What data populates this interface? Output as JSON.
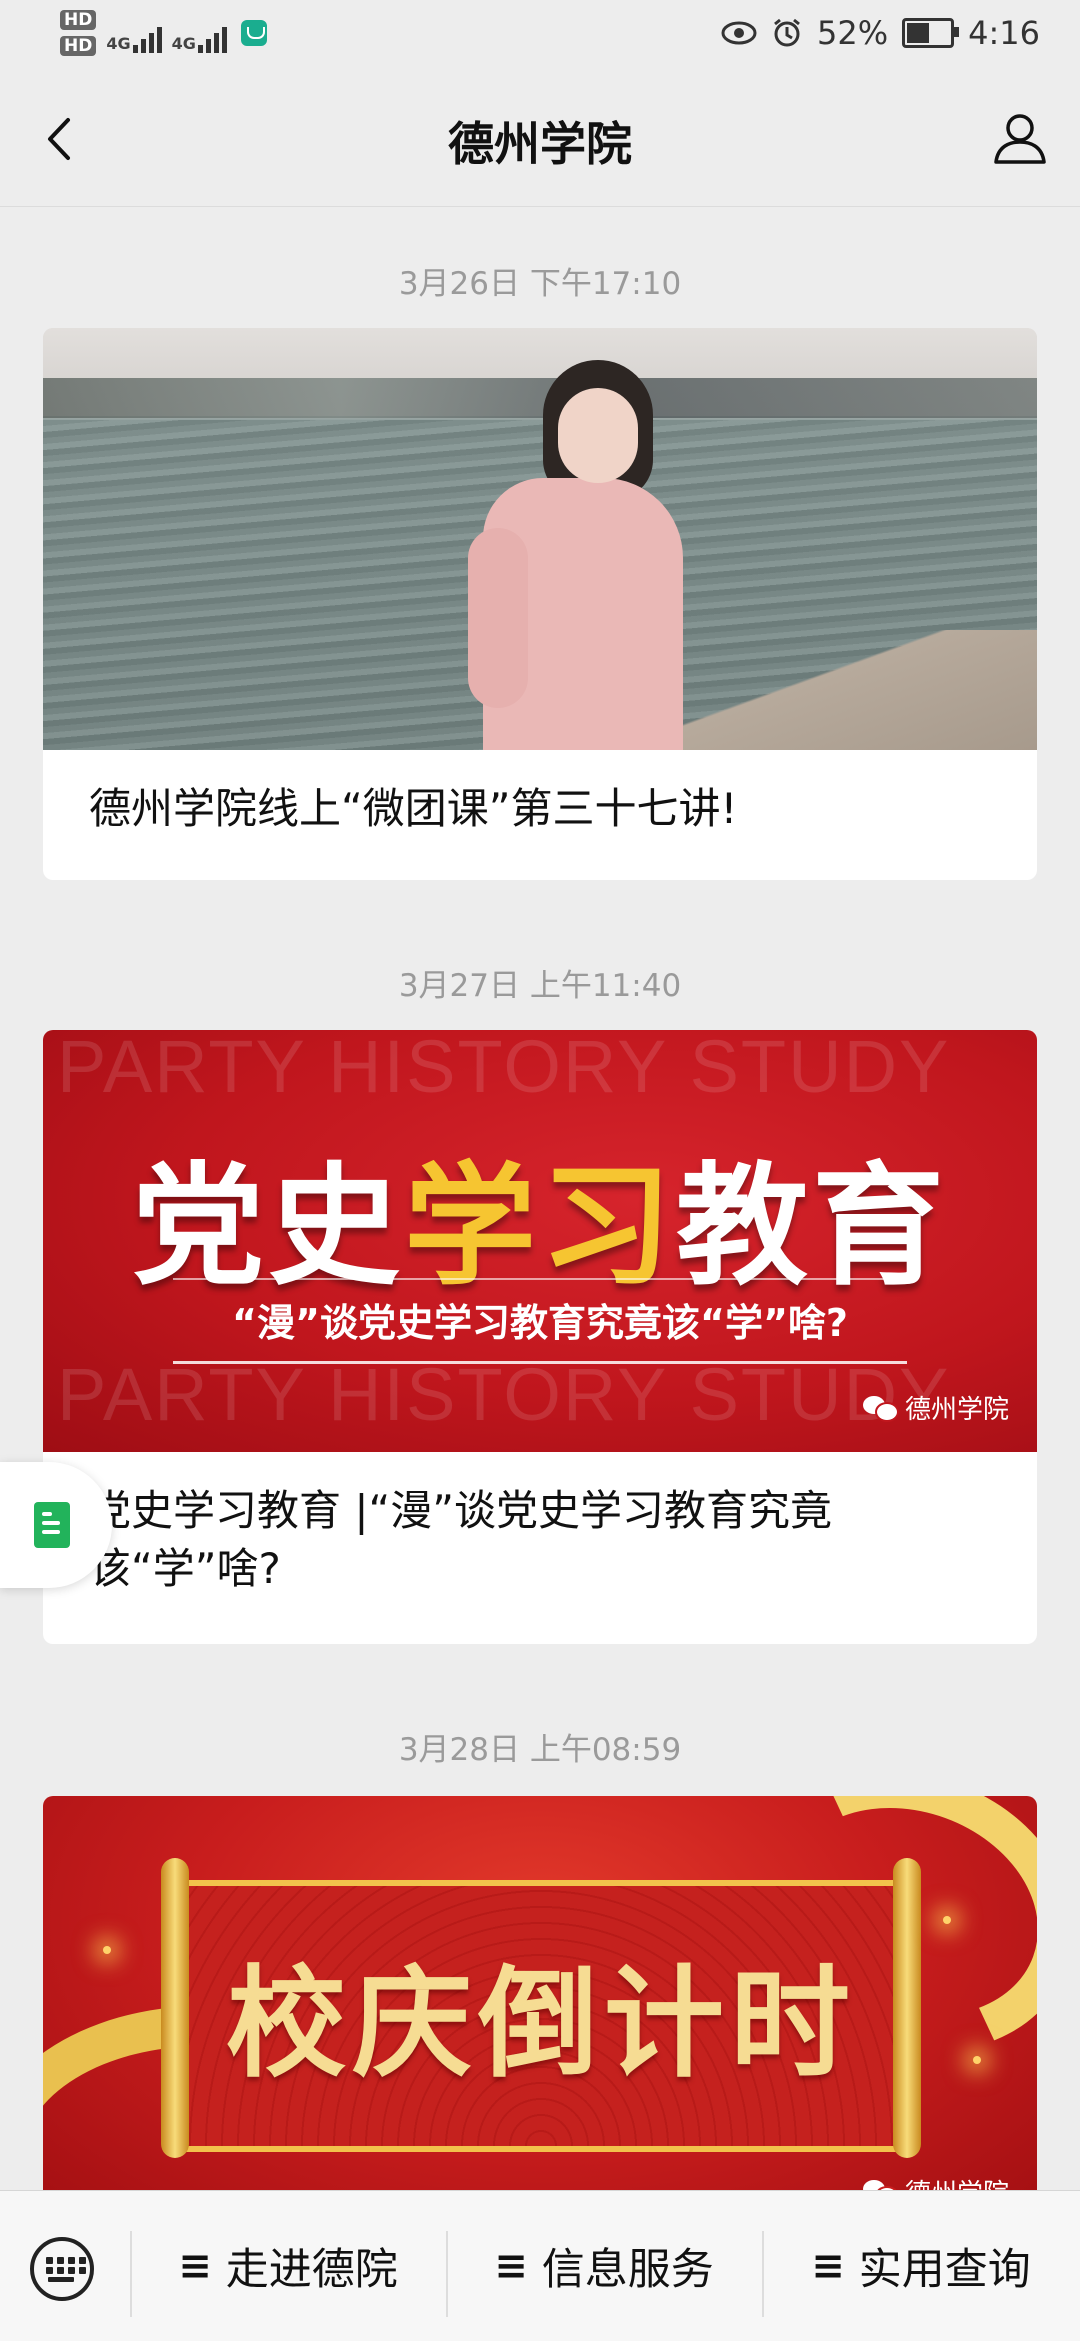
{
  "status_bar": {
    "hd1": "HD",
    "hd2": "HD",
    "net1": "4G",
    "net2": "4G",
    "battery_percent": "52%",
    "time": "4:16"
  },
  "header": {
    "title": "德州学院"
  },
  "feed": [
    {
      "date": "3月26日 下午17:10",
      "caption": "德州学院线上“微团课”第三十七讲!"
    },
    {
      "date": "3月27日 上午11:40",
      "caption": "党史学习教育 |“漫”谈党史学习教育究竟该“学”啥?",
      "image": {
        "watermark": "PARTY HISTORY STUDY",
        "title_white_1": "党史",
        "title_yellow": "学习",
        "title_white_2": "教育",
        "subtitle": "“漫”谈党史学习教育究竟该“学”啥?",
        "badge": "德州学院"
      }
    },
    {
      "date": "3月28日 上午08:59",
      "image": {
        "title": "校庆倒计时",
        "badge": "德州学院"
      }
    }
  ],
  "bottom_menu": [
    {
      "label": "走进德院"
    },
    {
      "label": "信息服务"
    },
    {
      "label": "实用查询"
    }
  ],
  "colors": {
    "background": "#ededed",
    "party_red": "#c0161d",
    "party_yellow": "#f6c531",
    "doc_green": "#22b35b"
  }
}
